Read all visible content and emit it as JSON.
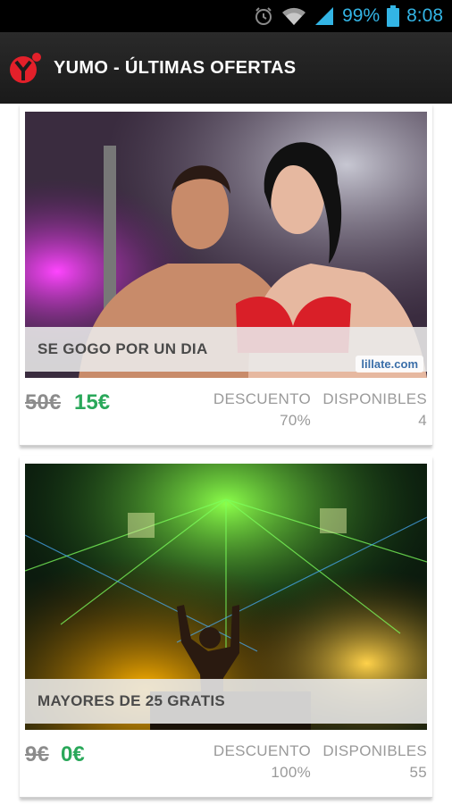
{
  "status_bar": {
    "battery_percent": "99%",
    "time": "8:08",
    "icons": [
      "alarm-icon",
      "wifi-icon",
      "signal-icon",
      "battery-icon"
    ],
    "color": "#33b5e5"
  },
  "header": {
    "title": "YUMO - ÚLTIMAS OFERTAS",
    "logo_icon": "yumo-logo-icon",
    "accent": "#e3202a"
  },
  "offers": [
    {
      "title": "SE GOGO POR UN DIA",
      "image_watermark": "lillate.com",
      "old_price": "50€",
      "new_price": "15€",
      "discount_label": "DESCUENTO",
      "discount_value": "70%",
      "available_label": "DISPONIBLES",
      "available_value": "4"
    },
    {
      "title": "MAYORES DE 25 GRATIS",
      "old_price": "9€",
      "new_price": "0€",
      "discount_label": "DESCUENTO",
      "discount_value": "100%",
      "available_label": "DISPONIBLES",
      "available_value": "55"
    }
  ],
  "colors": {
    "price_new": "#2aa85a",
    "price_old": "#8c8c8c",
    "stat_text": "#9a9a9a"
  }
}
